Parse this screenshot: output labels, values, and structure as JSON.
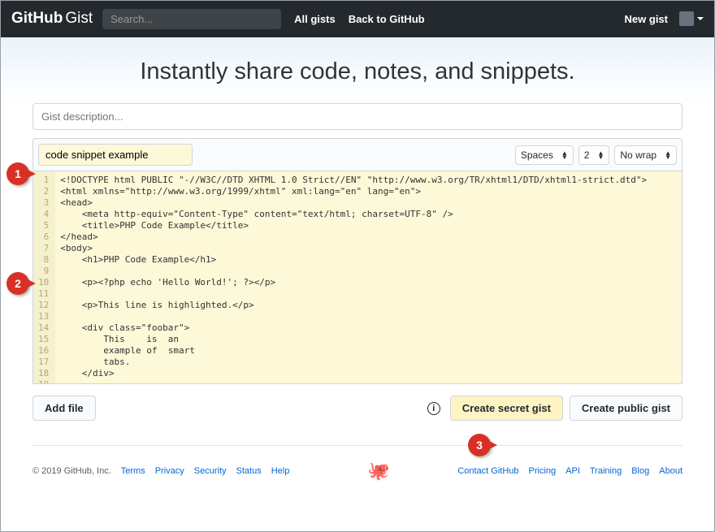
{
  "header": {
    "logo_bold": "GitHub",
    "logo_thin": "Gist",
    "search_placeholder": "Search...",
    "nav": {
      "all_gists": "All gists",
      "back": "Back to GitHub"
    },
    "new_gist": "New gist"
  },
  "hero": {
    "title": "Instantly share code, notes, and snippets."
  },
  "form": {
    "description_placeholder": "Gist description...",
    "filename": "code snippet example",
    "indent_mode": "Spaces",
    "indent_size": "2",
    "wrap_mode": "No wrap"
  },
  "code": {
    "lines": [
      "<!DOCTYPE html PUBLIC \"-//W3C//DTD XHTML 1.0 Strict//EN\" \"http://www.w3.org/TR/xhtml1/DTD/xhtml1-strict.dtd\">",
      "<html xmlns=\"http://www.w3.org/1999/xhtml\" xml:lang=\"en\" lang=\"en\">",
      "<head>",
      "    <meta http-equiv=\"Content-Type\" content=\"text/html; charset=UTF-8\" />",
      "    <title>PHP Code Example</title>",
      "</head>",
      "<body>",
      "    <h1>PHP Code Example</h1>",
      "",
      "    <p><?php echo 'Hello World!'; ?></p>",
      "",
      "    <p>This line is highlighted.</p>",
      "",
      "    <div class=\"foobar\">",
      "        This    is  an",
      "        example of  smart",
      "        tabs.",
      "    </div>",
      ""
    ]
  },
  "actions": {
    "add_file": "Add file",
    "secret": "Create secret gist",
    "public": "Create public gist"
  },
  "callouts": {
    "c1": "1",
    "c2": "2",
    "c3": "3"
  },
  "footer": {
    "copyright": "© 2019 GitHub, Inc.",
    "left": {
      "terms": "Terms",
      "privacy": "Privacy",
      "security": "Security",
      "status": "Status",
      "help": "Help"
    },
    "right": {
      "contact": "Contact GitHub",
      "pricing": "Pricing",
      "api": "API",
      "training": "Training",
      "blog": "Blog",
      "about": "About"
    }
  }
}
